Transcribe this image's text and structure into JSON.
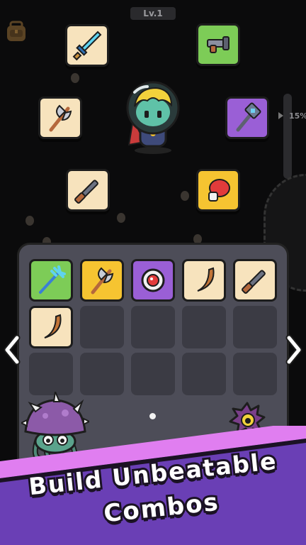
{
  "hud": {
    "level_label": "Lv.1",
    "percent_label": "15%"
  },
  "weapons_around_hero": [
    {
      "name": "ice-sword",
      "color": "#f7e3bd"
    },
    {
      "name": "blaster-gun",
      "color": "#7dcc57"
    },
    {
      "name": "battle-axe",
      "color": "#f7e3bd"
    },
    {
      "name": "war-hammer",
      "color": "#9a5fd6"
    },
    {
      "name": "rifle",
      "color": "#f7e3bd"
    },
    {
      "name": "boxing-glove",
      "color": "#f6c431"
    }
  ],
  "inventory": {
    "rows": 3,
    "cols": 5,
    "items": [
      {
        "name": "trident",
        "color": "#7dcc57"
      },
      {
        "name": "battle-axe",
        "color": "#f6c431"
      },
      {
        "name": "target-drone",
        "color": "#9a5fd6"
      },
      {
        "name": "boomerang",
        "color": "#f7e3bd"
      },
      {
        "name": "rifle",
        "color": "#f7e3bd"
      },
      {
        "name": "boomerang",
        "color": "#f7e3bd"
      }
    ],
    "page_count": 1
  },
  "banner": {
    "line1": "Build Unbeatable",
    "line2": "Combos",
    "stripe_color": "#e07ef0",
    "band_color": "#6a3fb5"
  },
  "colors": {
    "background": "#0b0b0c",
    "panel": "#4d4d58",
    "empty_slot": "#3b3b44"
  }
}
